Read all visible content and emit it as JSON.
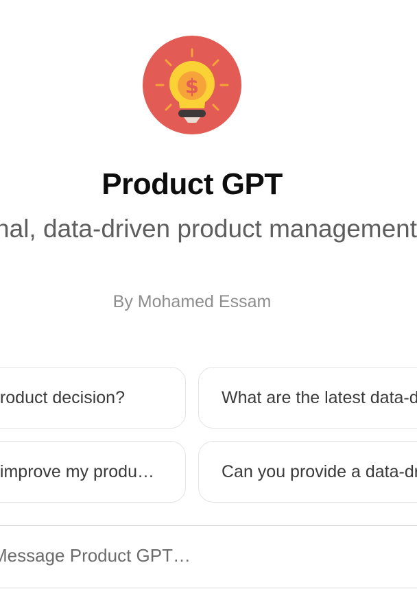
{
  "gpt": {
    "logo_icon": "lightbulb-dollar-icon",
    "title": "Product GPT",
    "description": "Professional, data-driven product management expert",
    "author": "By Mohamed Essam"
  },
  "prompts": [
    {
      "label": "How can I use data to make a product decision?"
    },
    {
      "label": "What are the latest data-driven product trends?"
    },
    {
      "label": "What metrics should I track to improve my produ…"
    },
    {
      "label": "Can you provide a data-driven roadmap?"
    }
  ],
  "composer": {
    "placeholder": "Message Product GPT…"
  },
  "colors": {
    "logo_bg": "#e35b55",
    "bulb": "#fbd236",
    "title": "#0d0d0d",
    "description": "#5d5d5d",
    "author": "#8e8e8e"
  }
}
